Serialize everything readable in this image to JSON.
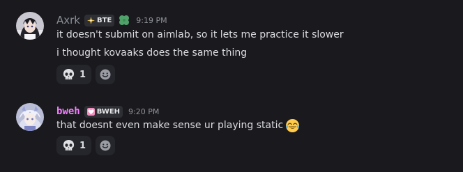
{
  "messages": [
    {
      "username": "Axrk",
      "tag": "BTE",
      "role_icon": "clover-icon",
      "timestamp": "9:19 PM",
      "lines": [
        "it doesn't submit on aimlab, so it lets me practice it slower",
        "i thought kovaaks does the same thing"
      ],
      "reactions": [
        {
          "emoji": "skull-emoji",
          "count": "1"
        }
      ]
    },
    {
      "username": "bweh",
      "tag": "BWEH",
      "timestamp": "9:20 PM",
      "lines": [
        "that doesnt even make sense ur playing static"
      ],
      "trailing_emoji": "joy-emoji",
      "reactions": [
        {
          "emoji": "skull-emoji",
          "count": "1"
        }
      ]
    }
  ],
  "colors": {
    "background": "#1a1a1e",
    "username_1": "#8a8f98",
    "username_2": "#f47fff",
    "text": "#dcdde0",
    "tag_background": "#2e2f35",
    "reaction_background": "#25262b"
  }
}
